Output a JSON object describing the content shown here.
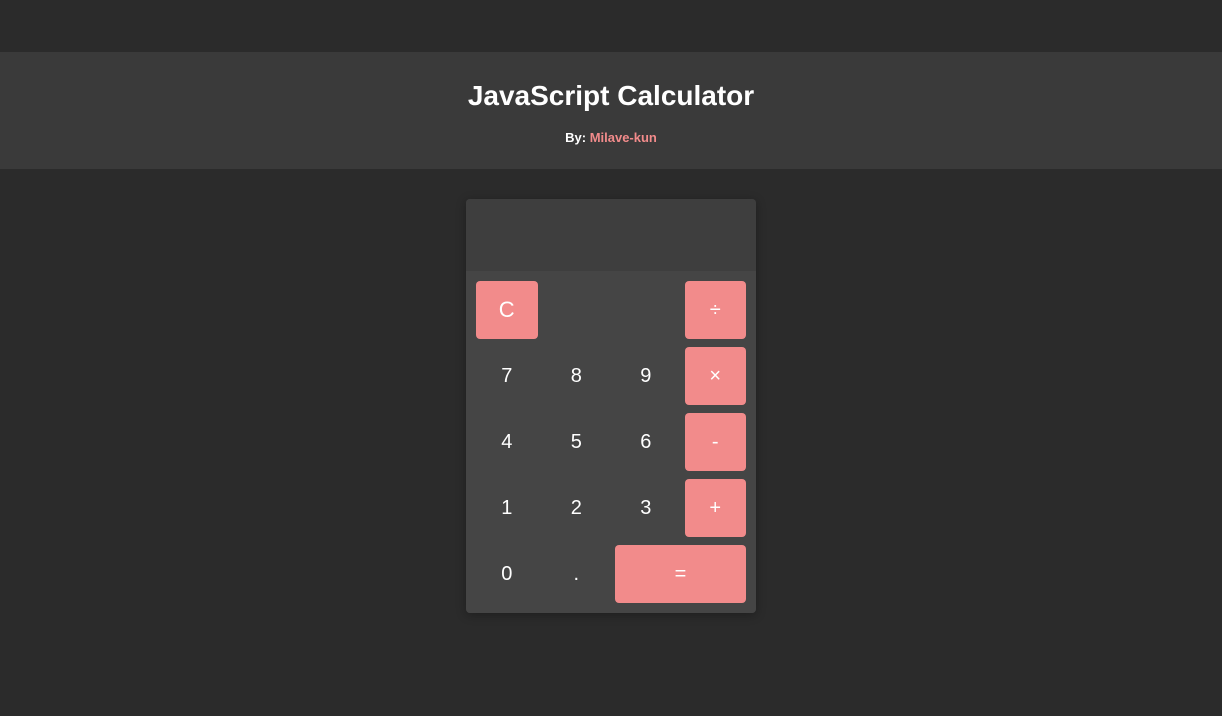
{
  "header": {
    "title": "JavaScript Calculator",
    "by_prefix": "By: ",
    "author": "Milave-kun"
  },
  "calculator": {
    "display_value": "",
    "buttons": {
      "clear": "C",
      "divide": "÷",
      "seven": "7",
      "eight": "8",
      "nine": "9",
      "multiply": "×",
      "four": "4",
      "five": "5",
      "six": "6",
      "subtract": "-",
      "one": "1",
      "two": "2",
      "three": "3",
      "add": "+",
      "zero": "0",
      "decimal": ".",
      "equals": "="
    }
  }
}
